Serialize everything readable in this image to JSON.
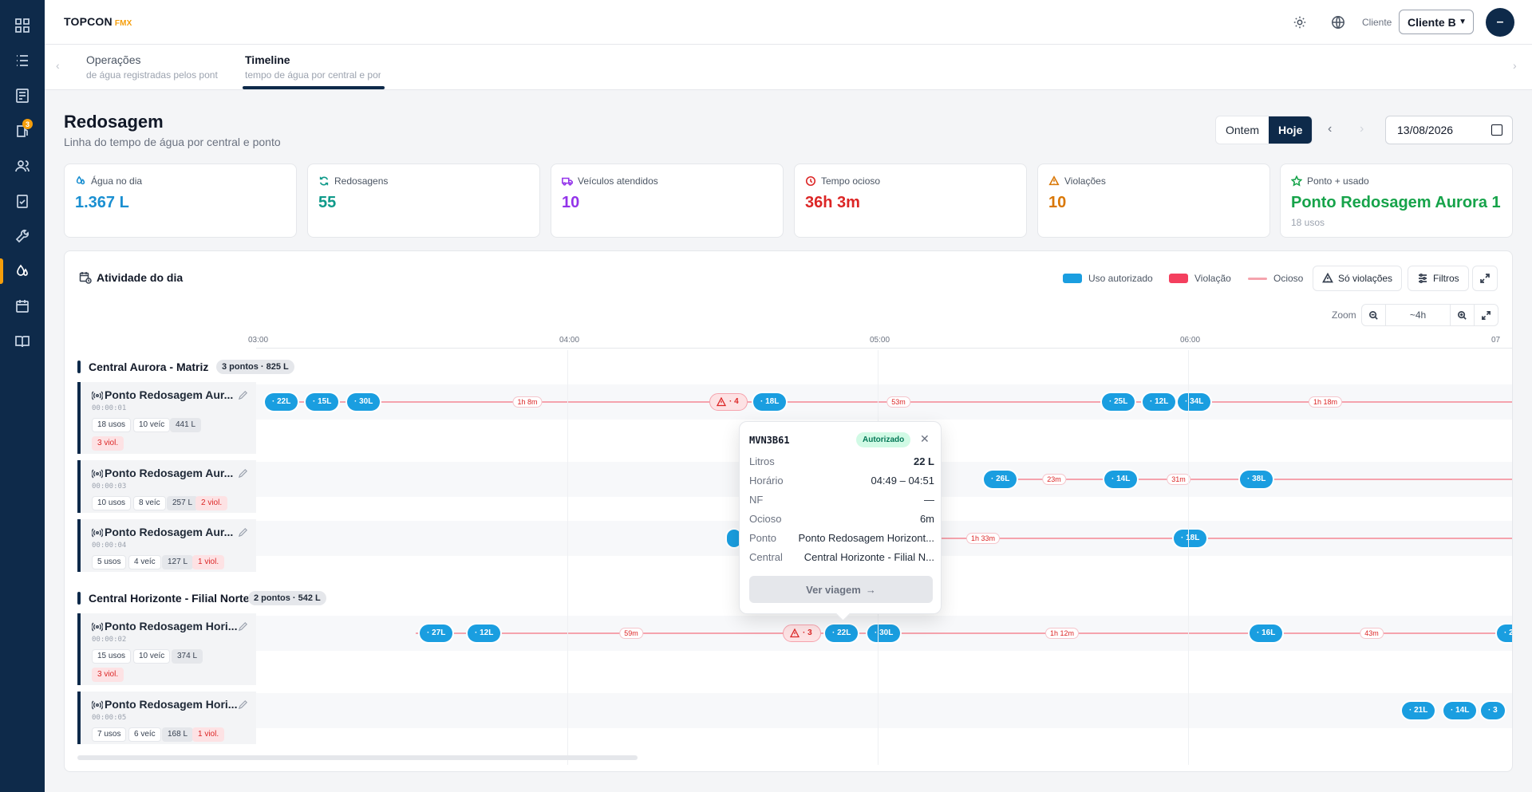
{
  "brand": {
    "name": "TOPCON",
    "suffix": "FMX"
  },
  "header": {
    "client_label": "Cliente",
    "client_value": "Cliente B",
    "user_initial": "–"
  },
  "sidebar": {
    "badge": "3"
  },
  "tabs": [
    {
      "title": "Operações",
      "subtitle": "de água registradas pelos pont"
    },
    {
      "title": "Timeline",
      "subtitle": "tempo de água por central e por"
    }
  ],
  "page": {
    "title": "Redosagem",
    "subtitle": "Linha do tempo de água por central e ponto",
    "day_yesterday": "Ontem",
    "day_today": "Hoje",
    "date": "13/08/2026"
  },
  "stats": [
    {
      "label": "Água no dia",
      "value": "1.367 L",
      "color": "#1a8fd1",
      "icon": "droplets-icon"
    },
    {
      "label": "Redosagens",
      "value": "55",
      "color": "#0f9a8a",
      "icon": "refresh-icon"
    },
    {
      "label": "Veículos atendidos",
      "value": "10",
      "color": "#9333ea",
      "icon": "truck-icon"
    },
    {
      "label": "Tempo ocioso",
      "value": "36h 3m",
      "color": "#dc2626",
      "icon": "clock-icon"
    },
    {
      "label": "Violações",
      "value": "10",
      "color": "#d97706",
      "icon": "warning-icon"
    },
    {
      "label": "Ponto + usado",
      "value": "Ponto Redosagem Aurora 1",
      "note": "18 usos",
      "color": "#16a34a",
      "icon": "star-icon"
    }
  ],
  "activity": {
    "title": "Atividade do dia",
    "legend": {
      "authorized": "Uso autorizado",
      "violation": "Violação",
      "idle": "Ocioso"
    },
    "only_violations": "Só violações",
    "filters": "Filtros",
    "zoom_label": "Zoom",
    "zoom_value": "~4h",
    "hours": [
      "03:00",
      "04:00",
      "05:00",
      "06:00",
      "07"
    ]
  },
  "groups": [
    {
      "name": "Central Aurora - Matriz",
      "pill": "3 pontos · 825 L"
    },
    {
      "name": "Central Horizonte - Filial Norte",
      "pill": "2 pontos · 542 L"
    }
  ],
  "rows": [
    {
      "name": "Ponto Redosagem Aur...",
      "code": "00:00:01",
      "chips": [
        "18 usos",
        "10 veíc",
        "441 L",
        "3 viol."
      ]
    },
    {
      "name": "Ponto Redosagem Aur...",
      "code": "00:00:03",
      "chips": [
        "10 usos",
        "8 veíc",
        "257 L",
        "2 viol."
      ]
    },
    {
      "name": "Ponto Redosagem Aur...",
      "code": "00:00:04",
      "chips": [
        "5 usos",
        "4 veíc",
        "127 L",
        "1 viol."
      ]
    },
    {
      "name": "Ponto Redosagem Hori...",
      "code": "00:00:02",
      "chips": [
        "15 usos",
        "10 veíc",
        "374 L",
        "3 viol."
      ]
    },
    {
      "name": "Ponto Redosagem Hori...",
      "code": "00:00:05",
      "chips": [
        "7 usos",
        "6 veíc",
        "168 L",
        "1 viol."
      ]
    }
  ],
  "events": {
    "r1": {
      "uses": [
        "· 22L",
        "· 15L",
        "· 30L",
        "· 18L",
        "· 25L",
        "· 12L",
        "· 34L"
      ],
      "viol": "· 4",
      "idle": [
        "1h 8m",
        "53m",
        "1h 18m"
      ]
    },
    "r2": {
      "uses": [
        "· 26L",
        "· 14L",
        "· 38L"
      ],
      "idle": [
        "23m",
        "31m"
      ]
    },
    "r3": {
      "uses": [
        "· 18L"
      ],
      "idle": [
        "1h 33m"
      ]
    },
    "r4": {
      "uses": [
        "· 27L",
        "· 12L",
        "· 22L",
        "· 30L",
        "· 16L",
        "· 2"
      ],
      "viol": "· 3",
      "idle": [
        "59m",
        "1h 12m",
        "43m"
      ]
    },
    "r5": {
      "uses": [
        "· 21L",
        "· 14L",
        "· 3"
      ]
    }
  },
  "popover": {
    "plate": "MVN3B61",
    "status": "Autorizado",
    "rows": [
      {
        "k": "Litros",
        "v": "22 L"
      },
      {
        "k": "Horário",
        "v": "04:49 – 04:51"
      },
      {
        "k": "NF",
        "v": "—"
      },
      {
        "k": "Ocioso",
        "v": "6m"
      },
      {
        "k": "Ponto",
        "v": "Ponto Redosagem Horizont..."
      },
      {
        "k": "Central",
        "v": "Central Horizonte - Filial N..."
      }
    ],
    "button": "Ver viagem"
  }
}
